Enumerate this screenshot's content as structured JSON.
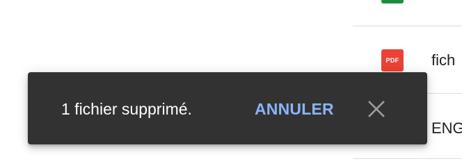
{
  "file_list": {
    "rows": [
      {
        "icon": "sheets-icon",
        "name": ""
      },
      {
        "icon": "pdf-icon",
        "icon_text": "PDF",
        "name": "fich"
      },
      {
        "icon": "none",
        "name": "ENG"
      }
    ]
  },
  "snackbar": {
    "message": "1 fichier supprimé.",
    "action_label": "ANNULER",
    "close_icon": "close-icon"
  },
  "colors": {
    "snackbar_bg": "#323232",
    "action": "#8ab4f8",
    "pdf_red": "#ea4335",
    "sheets_green": "#1e8e3e",
    "divider": "#dadce0"
  }
}
